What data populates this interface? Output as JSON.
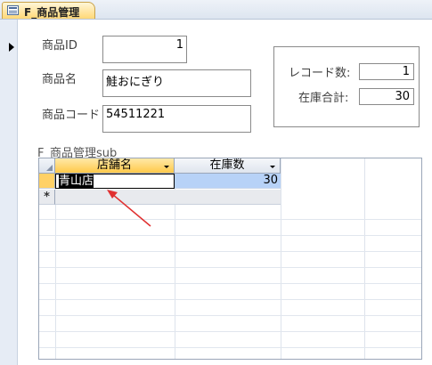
{
  "window": {
    "tab_label": "F_商品管理"
  },
  "fields": {
    "product_id": {
      "label": "商品ID",
      "value": "1"
    },
    "product_name": {
      "label": "商品名",
      "value": "鮭おにぎり"
    },
    "product_code": {
      "label": "商品コード",
      "value": "54511221"
    }
  },
  "summary": {
    "record_count": {
      "label": "レコード数:",
      "value": "1"
    },
    "stock_total": {
      "label": "在庫合計:",
      "value": "30"
    }
  },
  "subform": {
    "caption": "F_商品管理sub",
    "columns": [
      "店舗名",
      "在庫数"
    ],
    "rows": [
      {
        "store": "青山店",
        "stock": "30"
      }
    ],
    "new_record_marker": "*"
  },
  "colors": {
    "accent_tab": "#ffd877",
    "selected_cell": "#b7d2f7",
    "annotation_arrow": "#e03030"
  }
}
